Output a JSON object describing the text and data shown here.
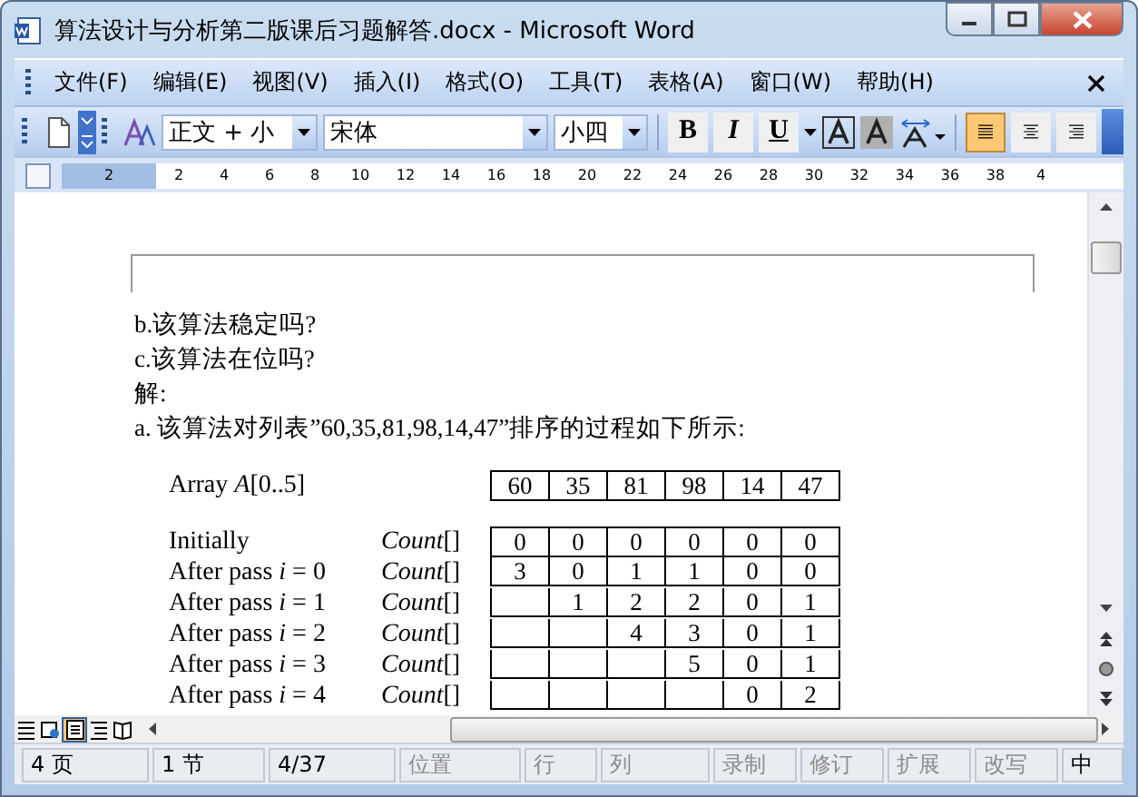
{
  "window": {
    "title": "算法设计与分析第二版课后习题解答.docx - Microsoft Word"
  },
  "menu": [
    "文件(F)",
    "编辑(E)",
    "视图(V)",
    "插入(I)",
    "格式(O)",
    "工具(T)",
    "表格(A)",
    "窗口(W)",
    "帮助(H)"
  ],
  "toolbar": {
    "style": "正文 + 小",
    "font": "宋体",
    "size": "小四",
    "format_buttons": [
      "B",
      "I",
      "U"
    ],
    "alignment": [
      {
        "kind": "justify",
        "selected": true
      },
      {
        "kind": "center",
        "selected": false
      },
      {
        "kind": "right",
        "selected": false
      }
    ]
  },
  "ruler": {
    "ticks": [
      "2",
      "2",
      "4",
      "6",
      "8",
      "10",
      "12",
      "14",
      "16",
      "18",
      "20",
      "22",
      "24",
      "26",
      "28",
      "30",
      "32",
      "34",
      "36",
      "38",
      "4"
    ]
  },
  "document": {
    "paragraphs": [
      "b.该算法稳定吗?",
      "c.该算法在位吗?",
      "解:",
      "a.  该算法对列表”60,35,81,98,14,47”排序的过程如下所示:"
    ],
    "figure": {
      "array_label": "Array *A*[0..5]",
      "array": [
        "60",
        "35",
        "81",
        "98",
        "14",
        "47"
      ],
      "rows": [
        {
          "label": "Initially",
          "count": "*Count*[]",
          "cells": [
            "0",
            "0",
            "0",
            "0",
            "0",
            "0"
          ]
        },
        {
          "label": "After pass *i* = 0",
          "count": "*Count*[]",
          "cells": [
            "3",
            "0",
            "1",
            "1",
            "0",
            "0"
          ]
        },
        {
          "label": "After pass *i* = 1",
          "count": "*Count*[]",
          "cells": [
            null,
            "1",
            "2",
            "2",
            "0",
            "1"
          ]
        },
        {
          "label": "After pass *i* = 2",
          "count": "*Count*[]",
          "cells": [
            null,
            null,
            "4",
            "3",
            "0",
            "1"
          ]
        },
        {
          "label": "After pass *i* = 3",
          "count": "*Count*[]",
          "cells": [
            null,
            null,
            null,
            "5",
            "0",
            "1"
          ]
        },
        {
          "label": "After pass *i* = 4",
          "count": "*Count*[]",
          "cells": [
            null,
            null,
            null,
            null,
            "0",
            "2"
          ]
        }
      ]
    }
  },
  "view_buttons": [
    {
      "kind": "normal",
      "selected": false
    },
    {
      "kind": "web",
      "selected": false
    },
    {
      "kind": "print",
      "selected": true
    },
    {
      "kind": "outline",
      "selected": false
    },
    {
      "kind": "reading",
      "selected": false
    }
  ],
  "status_bar": [
    {
      "text": "4 页",
      "disabled": false
    },
    {
      "text": "1 节",
      "disabled": false
    },
    {
      "text": "4/37",
      "disabled": false
    },
    {
      "text": "位置",
      "disabled": true
    },
    {
      "text": "行",
      "disabled": true
    },
    {
      "text": "列",
      "disabled": true
    },
    {
      "text": "录制",
      "disabled": true
    },
    {
      "text": "修订",
      "disabled": true
    },
    {
      "text": "扩展",
      "disabled": true
    },
    {
      "text": "改写",
      "disabled": true
    },
    {
      "text": "中",
      "disabled": false
    }
  ]
}
